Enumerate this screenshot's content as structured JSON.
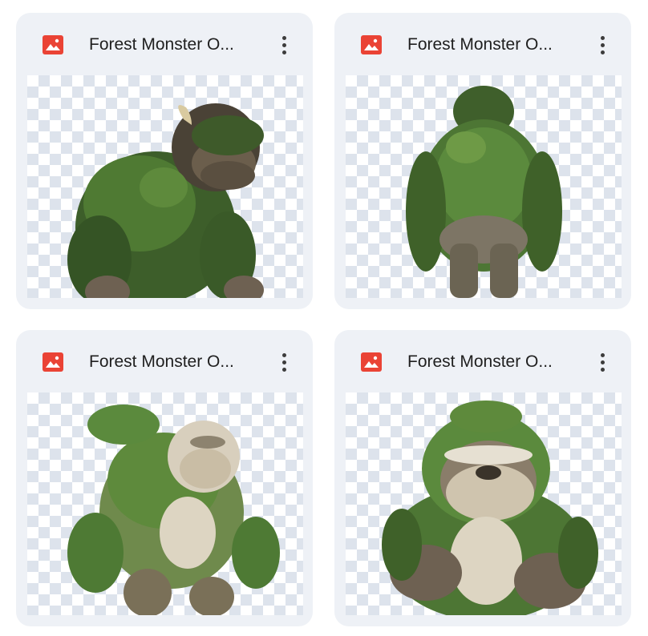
{
  "files": [
    {
      "name": "Forest Monster O...",
      "icon": "image-file-icon",
      "icon_color": "#ea4335"
    },
    {
      "name": "Forest Monster O...",
      "icon": "image-file-icon",
      "icon_color": "#ea4335"
    },
    {
      "name": "Forest Monster O...",
      "icon": "image-file-icon",
      "icon_color": "#ea4335"
    },
    {
      "name": "Forest Monster O...",
      "icon": "image-file-icon",
      "icon_color": "#ea4335"
    }
  ],
  "colors": {
    "card_bg": "#eef1f6",
    "checker": "#dde3ec",
    "moss_dark": "#2f4a22",
    "moss": "#4f7a33",
    "fur": "#8a7d6a",
    "fur_light": "#d8cfbd"
  }
}
